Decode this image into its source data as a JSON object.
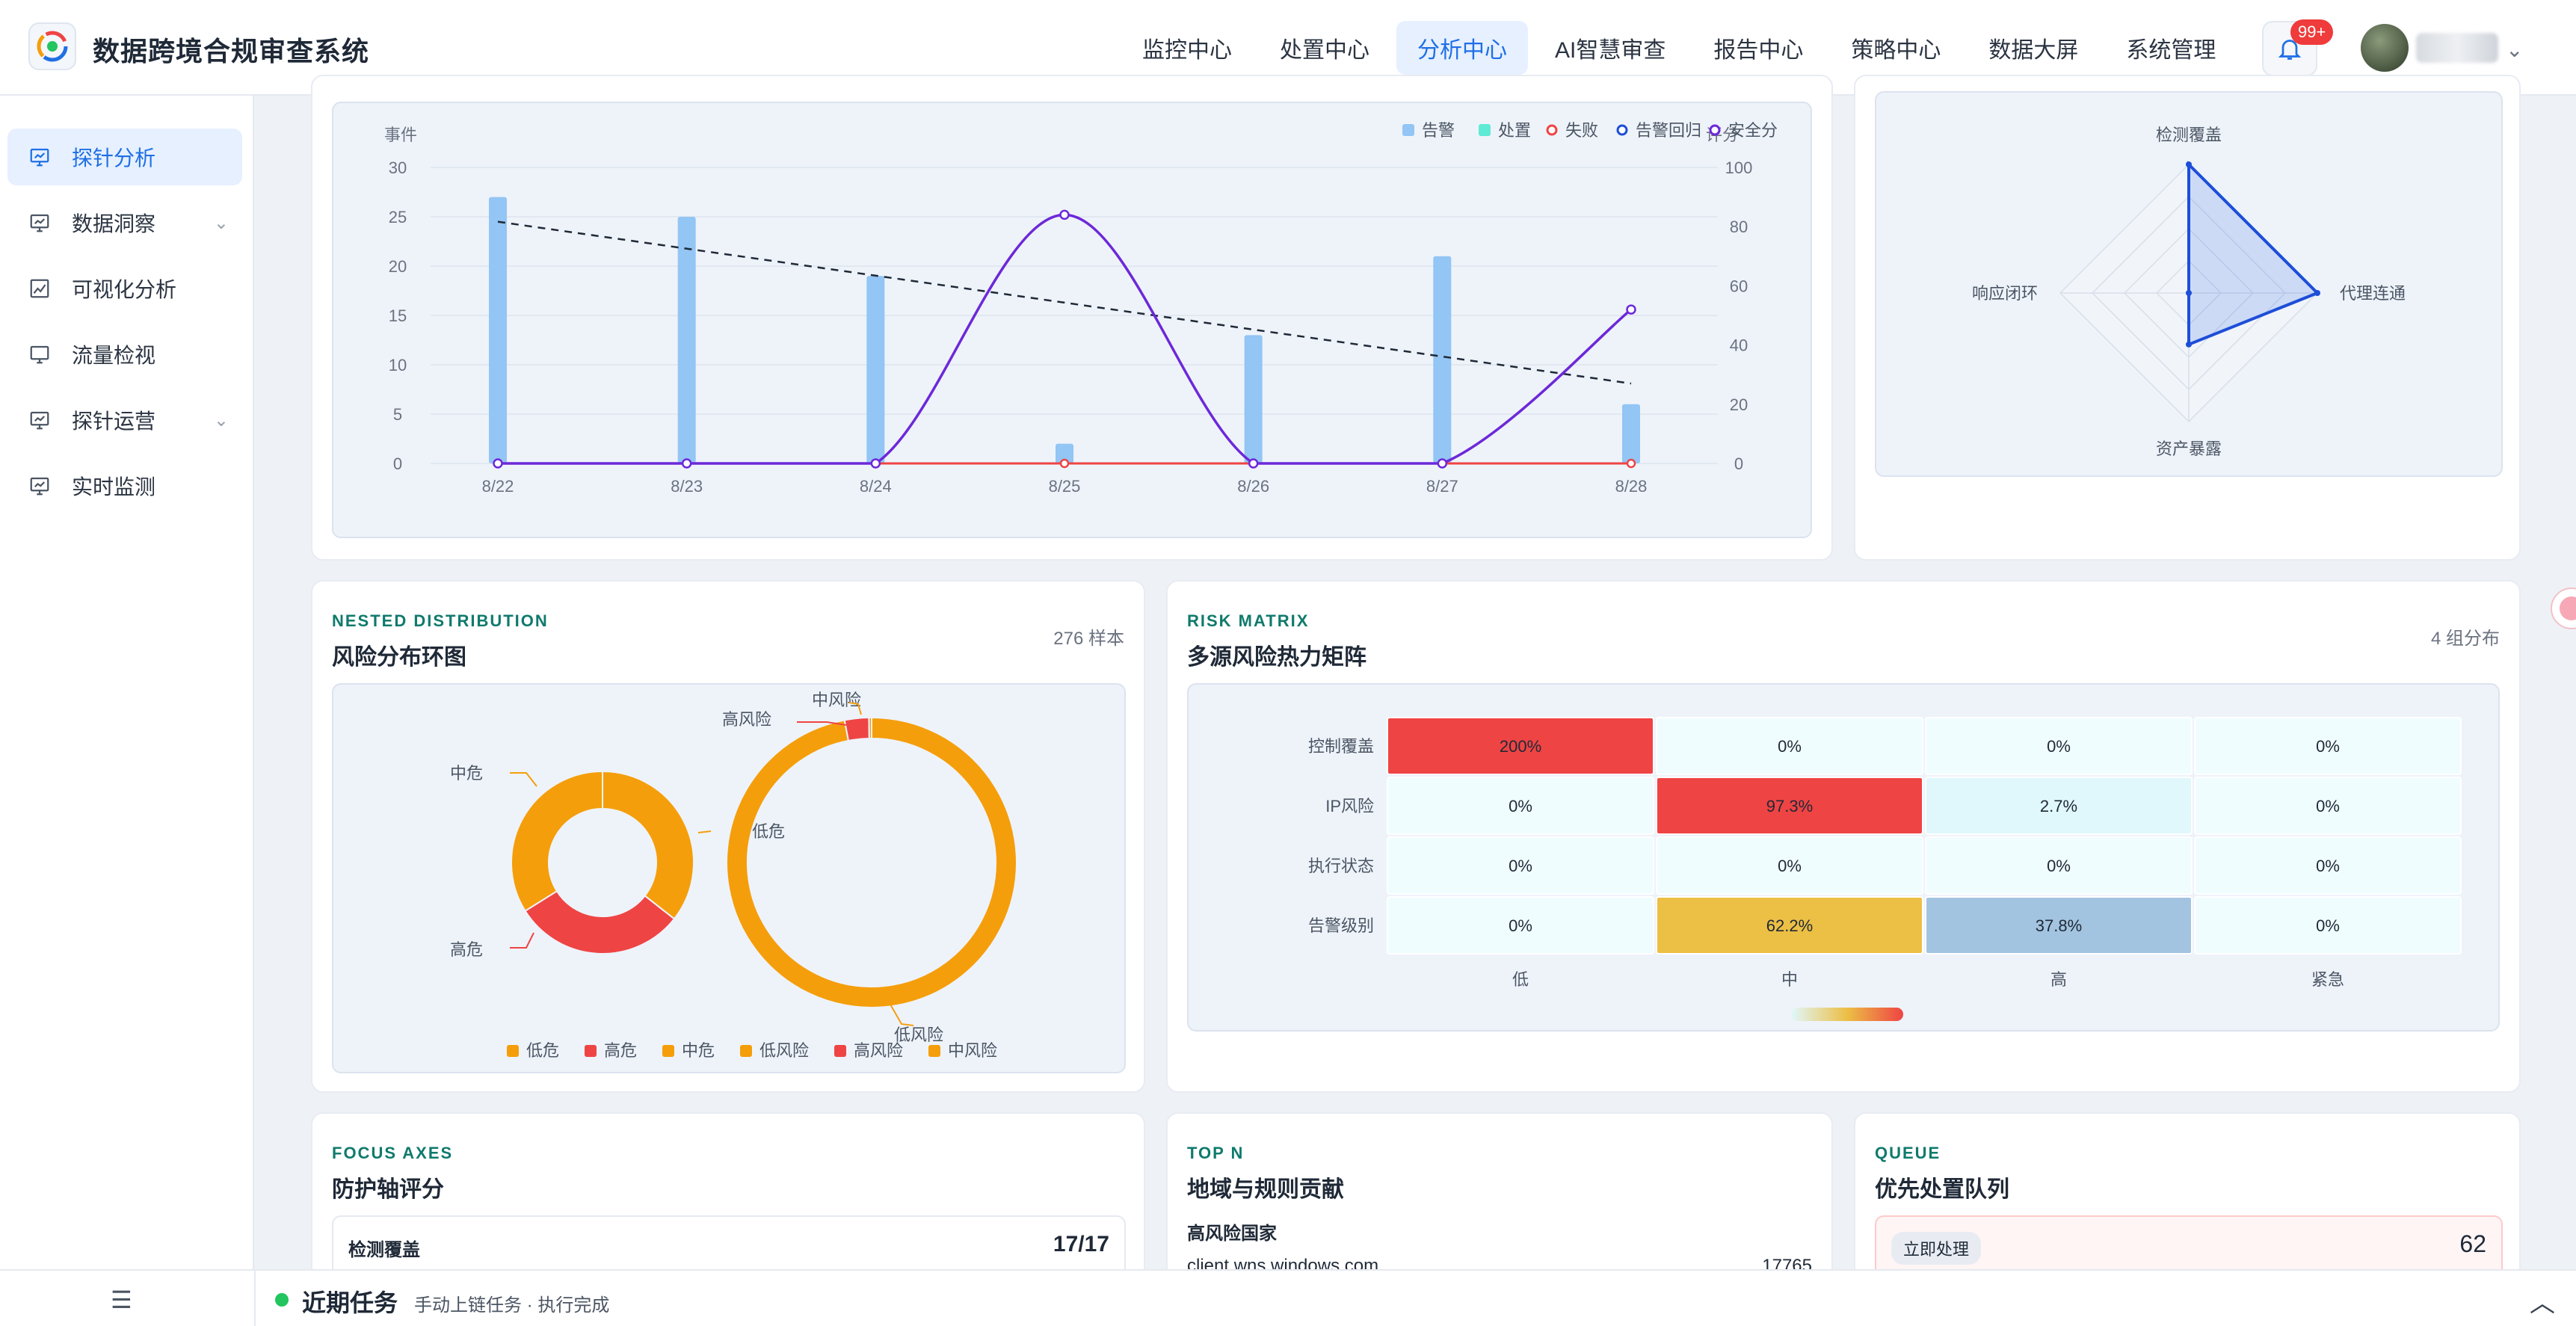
{
  "app": {
    "title": "数据跨境合规审查系统"
  },
  "nav": {
    "items": [
      "监控中心",
      "处置中心",
      "分析中心",
      "AI智慧审查",
      "报告中心",
      "策略中心",
      "数据大屏",
      "系统管理"
    ],
    "active": "分析中心"
  },
  "header": {
    "badge": "99+"
  },
  "sidebar": {
    "items": [
      {
        "label": "探针分析",
        "icon": "monitor-chart-icon",
        "active": true
      },
      {
        "label": "数据洞察",
        "icon": "monitor-chart-icon",
        "expandable": true
      },
      {
        "label": "可视化分析",
        "icon": "image-chart-icon"
      },
      {
        "label": "流量检视",
        "icon": "monitor-icon"
      },
      {
        "label": "探针运营",
        "icon": "monitor-chart-icon",
        "expandable": true
      },
      {
        "label": "实时监测",
        "icon": "monitor-chart-icon"
      }
    ]
  },
  "bottombar": {
    "title": "近期任务",
    "desc": "手动上链任务 · 执行完成"
  },
  "trend_card": {
    "chart_data": {
      "type": "bar",
      "categories": [
        "8/22",
        "8/23",
        "8/24",
        "8/25",
        "8/26",
        "8/27",
        "8/28"
      ],
      "ylabel": "事件",
      "y2label": "评分",
      "ylim": [
        0,
        30
      ],
      "y2lim": [
        0,
        100
      ],
      "yticks": [
        0,
        5,
        10,
        15,
        20,
        25,
        30
      ],
      "y2ticks": [
        0,
        20,
        40,
        60,
        80,
        100
      ],
      "legend_position": "top-right",
      "series": [
        {
          "name": "告警",
          "type": "bar",
          "axis": "left",
          "color": "#93c5f5",
          "values": [
            27,
            25,
            19,
            2,
            13,
            21,
            6
          ]
        },
        {
          "name": "处置",
          "type": "bar",
          "axis": "left",
          "color": "#5eead4",
          "values": [
            0,
            0,
            0,
            0,
            0,
            0,
            0
          ]
        },
        {
          "name": "失败",
          "type": "line",
          "axis": "left",
          "color": "#ef4444",
          "values": [
            0,
            0,
            0,
            0,
            0,
            0,
            0
          ]
        },
        {
          "name": "告警回归",
          "type": "line",
          "axis": "left",
          "color": "#1d4ed8",
          "dashed": true,
          "values": [
            24.5,
            21.8,
            19.1,
            16.3,
            13.6,
            10.9,
            8.1
          ]
        },
        {
          "name": "安全分",
          "type": "line",
          "axis": "right",
          "color": "#6d28d9",
          "smooth": true,
          "values": [
            0,
            0,
            0,
            84,
            0,
            0,
            52
          ]
        }
      ]
    }
  },
  "radar_card": {
    "chart_data": {
      "type": "radar",
      "indicators": [
        "检测覆盖",
        "代理连通",
        "资产暴露",
        "响应闭环"
      ],
      "values": [
        1.0,
        1.0,
        0.4,
        0.0
      ]
    }
  },
  "donut_card": {
    "en": "NESTED DISTRIBUTION",
    "cn": "风险分布环图",
    "meta": "276 样本",
    "chart_data": {
      "type": "pie",
      "rings": [
        {
          "slices": [
            {
              "label": "低危",
              "value": 42,
              "color": "#f59e0b"
            },
            {
              "label": "高危",
              "value": 36,
              "color": "#ef4444"
            },
            {
              "label": "中危",
              "value": 40,
              "color": "#f59e0b"
            }
          ]
        },
        {
          "slices": [
            {
              "label": "低风险",
              "value": 97.3,
              "color": "#f59e0b"
            },
            {
              "label": "高风险",
              "value": 2.7,
              "color": "#ef4444"
            },
            {
              "label": "中风险",
              "value": 0.3,
              "color": "#f59e0b"
            }
          ]
        }
      ],
      "legend": [
        {
          "label": "低危",
          "color": "#f59e0b"
        },
        {
          "label": "高危",
          "color": "#ef4444"
        },
        {
          "label": "中危",
          "color": "#f59e0b"
        },
        {
          "label": "低风险",
          "color": "#f59e0b"
        },
        {
          "label": "高风险",
          "color": "#ef4444"
        },
        {
          "label": "中风险",
          "color": "#f59e0b"
        }
      ]
    }
  },
  "heatmap_card": {
    "en": "RISK MATRIX",
    "cn": "多源风险热力矩阵",
    "meta": "4 组分布",
    "chart_data": {
      "type": "heatmap",
      "rows": [
        "控制覆盖",
        "IP风险",
        "执行状态",
        "告警级别"
      ],
      "cols": [
        "低",
        "中",
        "高",
        "紧急"
      ],
      "cells": [
        [
          "200%",
          "0%",
          "0%",
          "0%"
        ],
        [
          "0%",
          "97.3%",
          "2.7%",
          "0%"
        ],
        [
          "0%",
          "0%",
          "0%",
          "0%"
        ],
        [
          "0%",
          "62.2%",
          "37.8%",
          "0%"
        ]
      ],
      "colors": [
        [
          "#ef4444",
          "#f0fdff",
          "#f0fdff",
          "#f0fdff"
        ],
        [
          "#f0fdff",
          "#ef4444",
          "#e0f7fc",
          "#f0fdff"
        ],
        [
          "#f0fdff",
          "#f0fdff",
          "#f0fdff",
          "#f0fdff"
        ],
        [
          "#f0fdff",
          "#ecbf45",
          "#a3c4e0",
          "#f0fdff"
        ]
      ]
    }
  },
  "axes_card": {
    "en": "FOCUS AXES",
    "cn": "防护轴评分",
    "row_label": "检测覆盖",
    "row_value": "17/17"
  },
  "topn_card": {
    "en": "TOP N",
    "cn": "地域与规则贡献",
    "subhead": "高风险国家",
    "row_label": "client.wns.windows.com",
    "row_value": "17765"
  },
  "queue_card": {
    "en": "QUEUE",
    "cn": "优先处置队列",
    "chip": "立即处理",
    "value": "62"
  }
}
